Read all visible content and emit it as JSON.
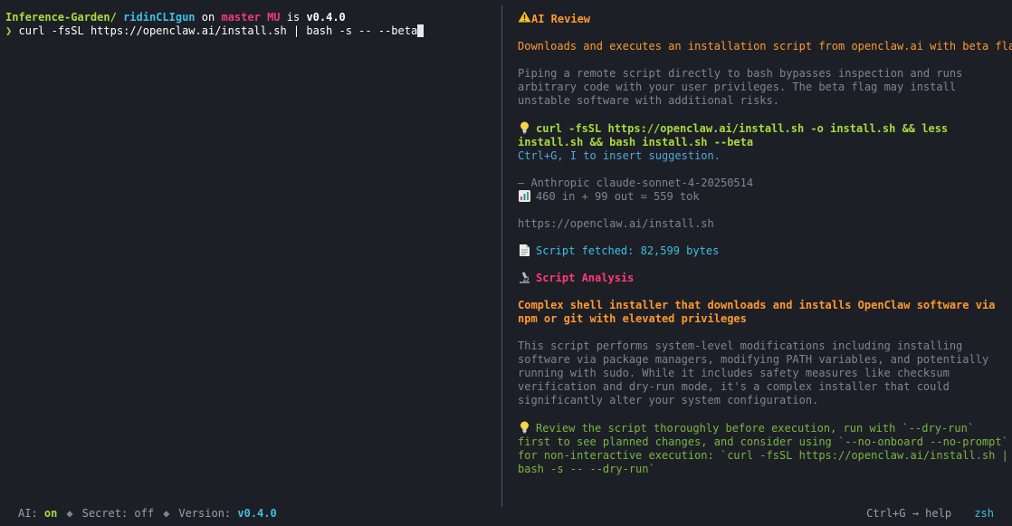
{
  "terminal": {
    "prompt": {
      "directory": "Inference-Garden/",
      "subdir": "ridinCLIgun",
      "on": "on",
      "branch": "master",
      "status": "MU",
      "is": "is",
      "version": "v0.4.0"
    },
    "command": {
      "caret": "❯",
      "text": "curl -fsSL https://openclaw.ai/install.sh | bash -s -- --beta"
    }
  },
  "review": {
    "title": "AI Review",
    "summary": "Downloads and executes an installation script from openclaw.ai with beta flag",
    "details": "Piping a remote script directly to bash bypasses inspection and runs arbitrary code with your user privileges. The beta flag may install unstable software with additional risks.",
    "suggestion": "curl -fsSL https://openclaw.ai/install.sh -o install.sh && less install.sh && bash install.sh --beta",
    "suggestion_hint": "Ctrl+G, I to insert suggestion.",
    "model": "— Anthropic claude-sonnet-4-20250514",
    "tokens": "460 in + 99 out = 559 tok",
    "url": "https://openclaw.ai/install.sh",
    "fetched": "Script fetched: 82,599 bytes",
    "analysis_title": "Script Analysis",
    "analysis_summary": "Complex shell installer that downloads and installs OpenClaw software via npm or git with elevated privileges",
    "analysis_details": "This script performs system-level modifications including installing software via package managers, modifying PATH variables, and potentially running with sudo. While it includes safety measures like checksum verification and dry-run mode, it's a complex installer that could significantly alter your system configuration.",
    "analysis_tip": "Review the script thoroughly before execution, run with `--dry-run` first to see planned changes, and consider using `--no-onboard --no-prompt` for non-interactive execution: `curl -fsSL https://openclaw.ai/install.sh | bash -s -- --dry-run`"
  },
  "status": {
    "ai_label": "AI:",
    "ai_value": "on",
    "diamond": "◆",
    "secret_label": "Secret:",
    "secret_value": "off",
    "version_label": "Version:",
    "version_value": "v0.4.0",
    "help": "Ctrl+G → help",
    "shell": "zsh"
  },
  "icons": {
    "warning": "warning-icon",
    "bulb": "lightbulb-icon",
    "chart": "bar-chart-icon",
    "document": "document-icon",
    "microscope": "microscope-icon"
  }
}
